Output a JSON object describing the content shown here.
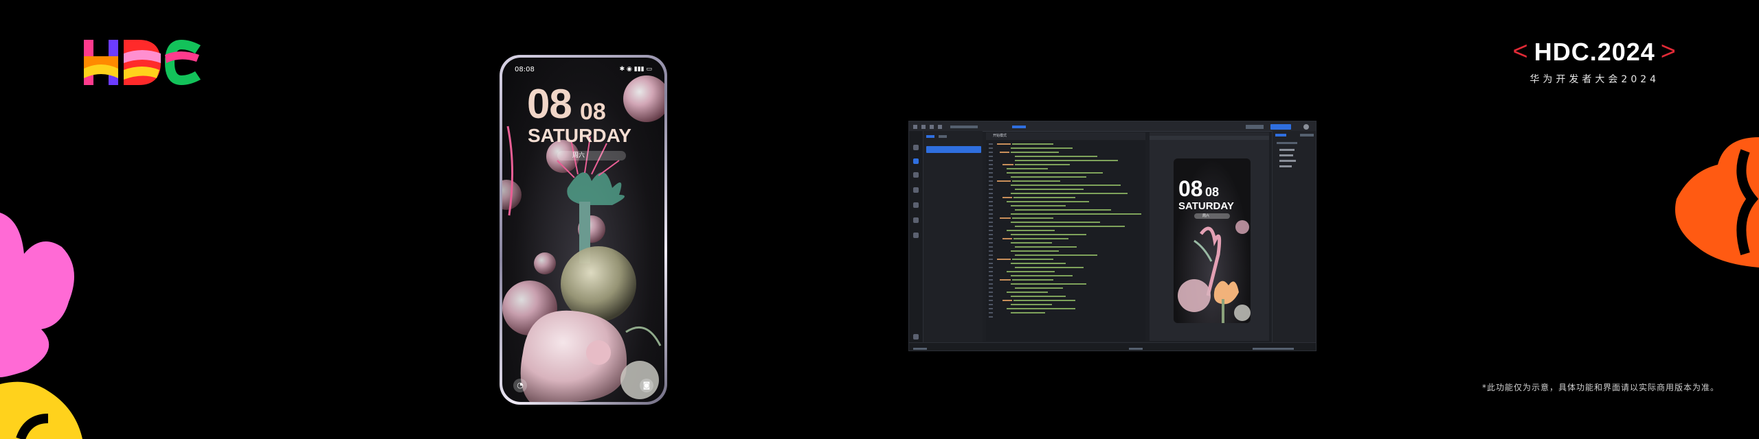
{
  "brand": {
    "title": "HDC.2024",
    "subtitle": "华为开发者大会2024",
    "chevron_left": "<",
    "chevron_right": ">"
  },
  "logo_text": "HDC",
  "disclaimer": "*此功能仅为示意，具体功能和界面请以实际商用版本为准。",
  "phone": {
    "status_time": "08:08",
    "status_icons": "✱ ◉ ▮▮▮ ▭",
    "hour": "08",
    "minute": "08",
    "day": "SATURDAY",
    "date_label": "周六",
    "left_button_icon": "unlock-icon",
    "right_button_icon": "camera-icon"
  },
  "ide": {
    "editor_title": "开始模式",
    "preview": {
      "hour": "08",
      "minute": "08",
      "day": "SATURDAY",
      "date_label": "周六"
    }
  },
  "colors": {
    "brand_red": "#e02a36",
    "accent_blue": "#2f6fdf",
    "lock_text": "#f1d6c8"
  }
}
